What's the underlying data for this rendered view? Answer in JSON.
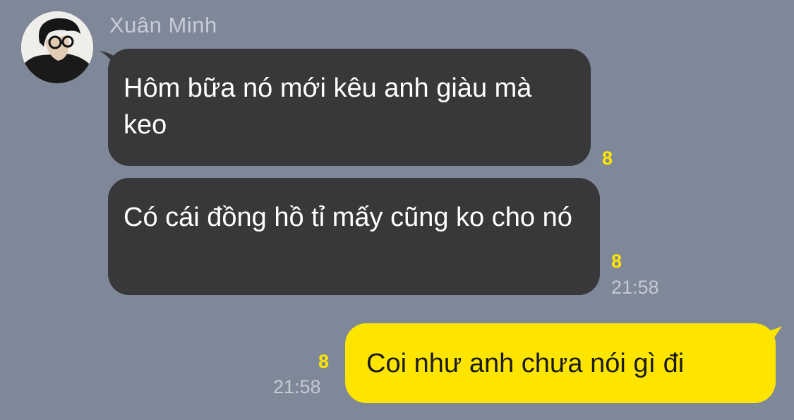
{
  "contact": {
    "name": "Xuân Minh",
    "avatar_icon": "profile-photo"
  },
  "messages": [
    {
      "direction": "incoming",
      "text": "Hôm bữa nó mới kêu anh giàu mà keo",
      "unread": "8",
      "time": ""
    },
    {
      "direction": "incoming",
      "text": "Có cái đồng hồ tỉ mấy cũng ko cho nó",
      "unread": "8",
      "time": "21:58"
    },
    {
      "direction": "outgoing",
      "text": "Coi như anh chưa nói gì đi",
      "unread": "8",
      "time": "21:58"
    }
  ],
  "colors": {
    "background": "#7f8898",
    "incoming_bubble": "#38383b",
    "outgoing_bubble": "#fee500",
    "unread_count": "#fee500"
  }
}
